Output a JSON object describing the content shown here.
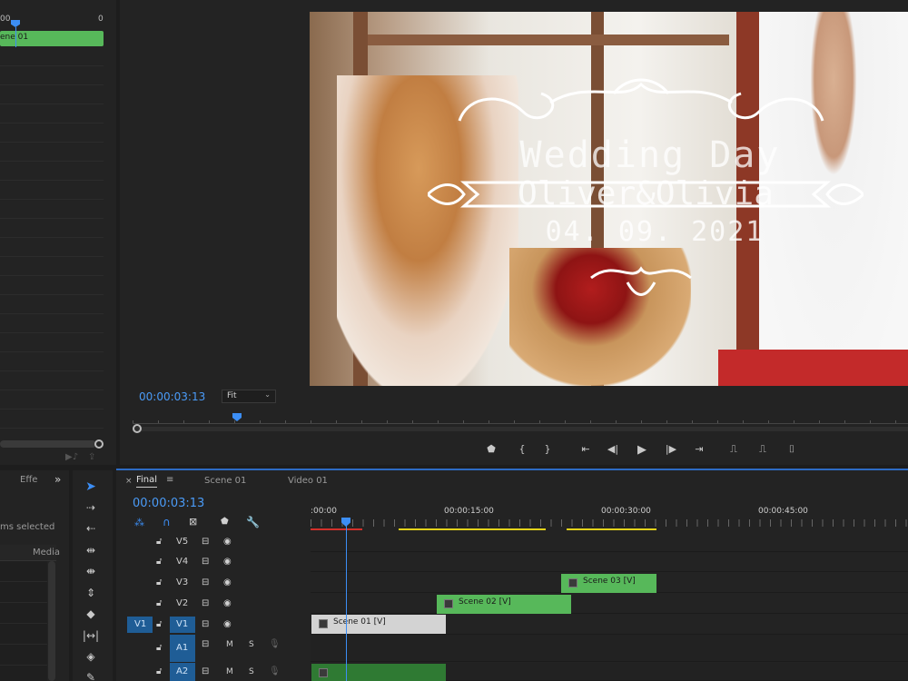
{
  "source_monitor": {
    "ruler_start": "00",
    "ruler_end": "0",
    "clip_label": "ene 01"
  },
  "program_monitor": {
    "timecode": "00:00:03:13",
    "zoom": "Fit",
    "overlay": {
      "title": "Wedding Day",
      "names": "Oliver&Olivia",
      "date": "04. 09. 2021"
    }
  },
  "project_panel": {
    "tab_effects": "Effe",
    "items_selected": "ms selected",
    "col_media": "Media"
  },
  "timeline": {
    "tabs": [
      {
        "label": "Final",
        "active": true
      },
      {
        "label": "Scene 01",
        "active": false
      },
      {
        "label": "Video 01",
        "active": false
      }
    ],
    "timecode": "00:00:03:13",
    "ruler_labels": [
      ":00:00",
      "00:00:15:00",
      "00:00:30:00",
      "00:00:45:00"
    ],
    "tracks": [
      {
        "name": "V5",
        "row": 0
      },
      {
        "name": "V4",
        "row": 1
      },
      {
        "name": "V3",
        "row": 2
      },
      {
        "name": "V2",
        "row": 3
      },
      {
        "name": "V1",
        "row": 4,
        "source": "V1"
      },
      {
        "name": "A1",
        "row": 5
      },
      {
        "name": "A2",
        "row": 6
      }
    ],
    "mute_label": "M",
    "solo_label": "S",
    "clips": [
      {
        "label": "Scene 03 [V]",
        "track": "V3"
      },
      {
        "label": "Scene 02 [V]",
        "track": "V2"
      },
      {
        "label": "Scene 01 [V]",
        "track": "V1"
      }
    ]
  },
  "colors": {
    "accent": "#3c8ef5",
    "clip_green": "#57b85a",
    "clip_gray": "#d3d3d3",
    "panel_bg": "#232323"
  }
}
